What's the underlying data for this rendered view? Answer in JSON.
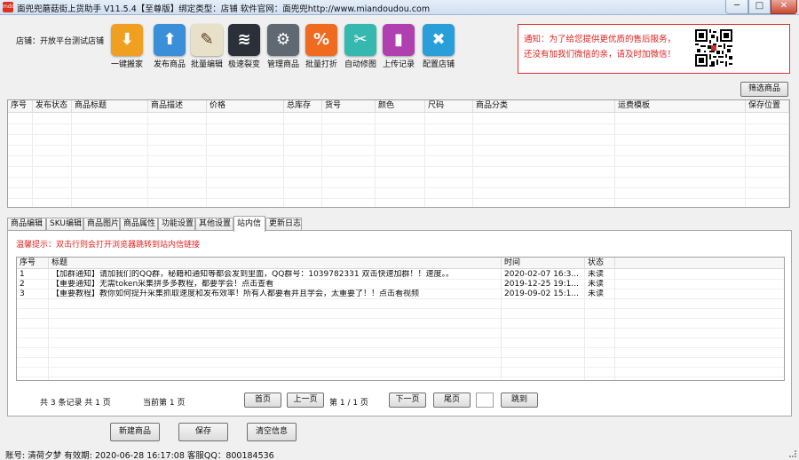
{
  "window": {
    "title": "面兜兜蘑菇街上货助手 V11.5.4【至尊版】绑定类型：店铺  软件官网：面兜兜http://www.miandoudou.com",
    "icon_text": "mdd",
    "min": "─",
    "max": "□",
    "close": "✕"
  },
  "shop": {
    "label": "店铺：开放平台测试店铺"
  },
  "toolbar": [
    {
      "label": "一键搬家",
      "icon": "download-cloud-icon",
      "color": "#f0a020",
      "glyph": "⬇"
    },
    {
      "label": "发布商品",
      "icon": "upload-cloud-icon",
      "color": "#3a8fd8",
      "glyph": "⬆"
    },
    {
      "label": "批量编辑",
      "icon": "edit-document-icon",
      "color": "#e8e0c8",
      "glyph": "✎"
    },
    {
      "label": "极速裂变",
      "icon": "layers-icon",
      "color": "#2a2f38",
      "glyph": "≋"
    },
    {
      "label": "管理商品",
      "icon": "gear-icon",
      "color": "#606872",
      "glyph": "⚙"
    },
    {
      "label": "批量打折",
      "icon": "price-tag-icon",
      "color": "#f06a20",
      "glyph": "%"
    },
    {
      "label": "自动修图",
      "icon": "scissors-icon",
      "color": "#35b8b0",
      "glyph": "✂"
    },
    {
      "label": "上传记录",
      "icon": "bookmark-icon",
      "color": "#b040b0",
      "glyph": "▮"
    },
    {
      "label": "配置店铺",
      "icon": "tools-icon",
      "color": "#2a9ed8",
      "glyph": "✖"
    }
  ],
  "notice": {
    "line1": "通知：为了给您提供更优质的售后服务，",
    "line2": "还没有加我们微信的亲，请及时加微信！"
  },
  "filter_button": "筛选商品",
  "product_table": {
    "columns": [
      "序号",
      "发布状态",
      "商品标题",
      "商品描述",
      "价格",
      "总库存",
      "货号",
      "颜色",
      "尺码",
      "商品分类",
      "运费模板",
      "保存位置"
    ]
  },
  "tabs": [
    "商品编辑",
    "SKU编辑",
    "商品图片",
    "商品属性",
    "功能设置",
    "其他设置",
    "站内信",
    "更新日志"
  ],
  "active_tab": "站内信",
  "warm_tip": "温馨提示：双击行则会打开浏览器跳转到站内信链接",
  "messages": {
    "columns": [
      "序号",
      "标题",
      "时间",
      "状态"
    ],
    "rows": [
      {
        "no": "1",
        "title": "【加群通知】请加我们的QQ群，秘籍和通知等都会发到里面，QQ群号：1039782331 双击快速加群！！速度。。",
        "time": "2020-02-07 16:3...",
        "status": "未读"
      },
      {
        "no": "2",
        "title": "【重要通知】无需token采集拼多多教程，都要学会！点击查看",
        "time": "2019-12-25 19:1...",
        "status": "未读"
      },
      {
        "no": "3",
        "title": "【重要教程】教你如何提升采集抓取速度和发布效率！所有人都要看并且学会，太重要了！！点击看视频",
        "time": "2019-09-02 15:1...",
        "status": "未读"
      }
    ]
  },
  "pager": {
    "total_text": "共  3  条记录   共 1 页",
    "current_text": "当前第  1  页",
    "first": "首页",
    "prev": "上一页",
    "page_text": "第  1  /  1  页",
    "next": "下一页",
    "last": "尾页",
    "goto": "跳到",
    "page_input": ""
  },
  "bottom_buttons": {
    "new": "新建商品",
    "save": "保存",
    "clear": "清空信息"
  },
  "status_bar": "账号: 清荷夕梦   有效期: 2020-06-28 16:17:08   客服QQ：800184536"
}
